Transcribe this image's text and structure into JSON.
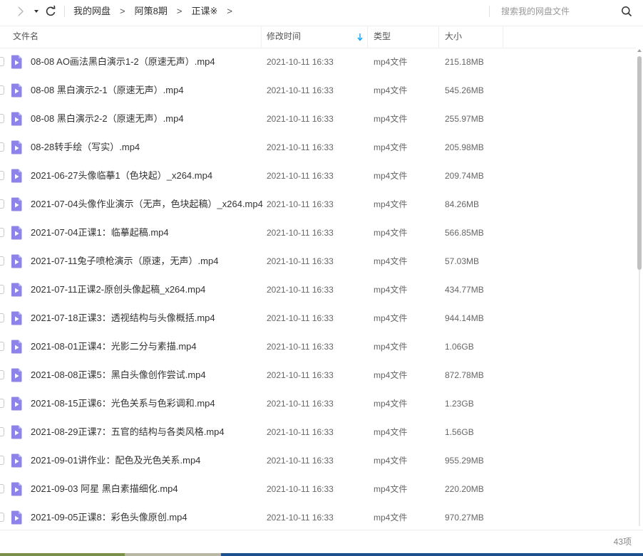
{
  "toolbar": {
    "forward_icon": "chevron-right-icon",
    "dropdown_icon": "caret-down-icon",
    "refresh_icon": "refresh-icon"
  },
  "breadcrumb": [
    {
      "label": "我的网盘"
    },
    {
      "label": "阿策8期"
    },
    {
      "label": "正课※"
    }
  ],
  "breadcrumb_separator": ">",
  "search": {
    "placeholder": "搜索我的网盘文件",
    "icon": "search-icon"
  },
  "columns": {
    "name": "文件名",
    "modified": "修改时间",
    "type": "类型",
    "size": "大小",
    "sorted_by": "modified",
    "sort_direction": "desc"
  },
  "files": [
    {
      "name": "08-08 AO画法黑白演示1-2（原速无声）.mp4",
      "date": "2021-10-11 16:33",
      "type": "mp4文件",
      "size": "215.18MB"
    },
    {
      "name": "08-08 黑白演示2-1（原速无声）.mp4",
      "date": "2021-10-11 16:33",
      "type": "mp4文件",
      "size": "545.26MB"
    },
    {
      "name": "08-08 黑白演示2-2（原速无声）.mp4",
      "date": "2021-10-11 16:33",
      "type": "mp4文件",
      "size": "255.97MB"
    },
    {
      "name": "08-28转手绘（写实）.mp4",
      "date": "2021-10-11 16:33",
      "type": "mp4文件",
      "size": "205.98MB"
    },
    {
      "name": "2021-06-27头像临摹1（色块起）_x264.mp4",
      "date": "2021-10-11 16:33",
      "type": "mp4文件",
      "size": "209.74MB"
    },
    {
      "name": "2021-07-04头像作业演示（无声，色块起稿）_x264.mp4",
      "date": "2021-10-11 16:33",
      "type": "mp4文件",
      "size": "84.26MB"
    },
    {
      "name": "2021-07-04正课1：临摹起稿.mp4",
      "date": "2021-10-11 16:33",
      "type": "mp4文件",
      "size": "566.85MB"
    },
    {
      "name": "2021-07-11兔子喷枪演示（原速，无声）.mp4",
      "date": "2021-10-11 16:33",
      "type": "mp4文件",
      "size": "57.03MB"
    },
    {
      "name": "2021-07-11正课2-原创头像起稿_x264.mp4",
      "date": "2021-10-11 16:33",
      "type": "mp4文件",
      "size": "434.77MB"
    },
    {
      "name": "2021-07-18正课3：透视结构与头像概括.mp4",
      "date": "2021-10-11 16:33",
      "type": "mp4文件",
      "size": "944.14MB"
    },
    {
      "name": "2021-08-01正课4：光影二分与素描.mp4",
      "date": "2021-10-11 16:33",
      "type": "mp4文件",
      "size": "1.06GB"
    },
    {
      "name": "2021-08-08正课5：黑白头像创作尝试.mp4",
      "date": "2021-10-11 16:33",
      "type": "mp4文件",
      "size": "872.78MB"
    },
    {
      "name": "2021-08-15正课6：光色关系与色彩调和.mp4",
      "date": "2021-10-11 16:33",
      "type": "mp4文件",
      "size": "1.23GB"
    },
    {
      "name": "2021-08-29正课7：五官的结构与各类风格.mp4",
      "date": "2021-10-11 16:33",
      "type": "mp4文件",
      "size": "1.56GB"
    },
    {
      "name": "2021-09-01讲作业：配色及光色关系.mp4",
      "date": "2021-10-11 16:33",
      "type": "mp4文件",
      "size": "955.29MB"
    },
    {
      "name": "2021-09-03 阿星 黑白素描细化.mp4",
      "date": "2021-10-11 16:33",
      "type": "mp4文件",
      "size": "220.20MB"
    },
    {
      "name": "2021-09-05正课8：彩色头像原创.mp4",
      "date": "2021-10-11 16:33",
      "type": "mp4文件",
      "size": "970.27MB"
    }
  ],
  "file_icon": "video-file-icon",
  "footer": {
    "count": "43项"
  },
  "colors": {
    "accent": "#06a7ff",
    "file_icon": "#8c84e8"
  }
}
